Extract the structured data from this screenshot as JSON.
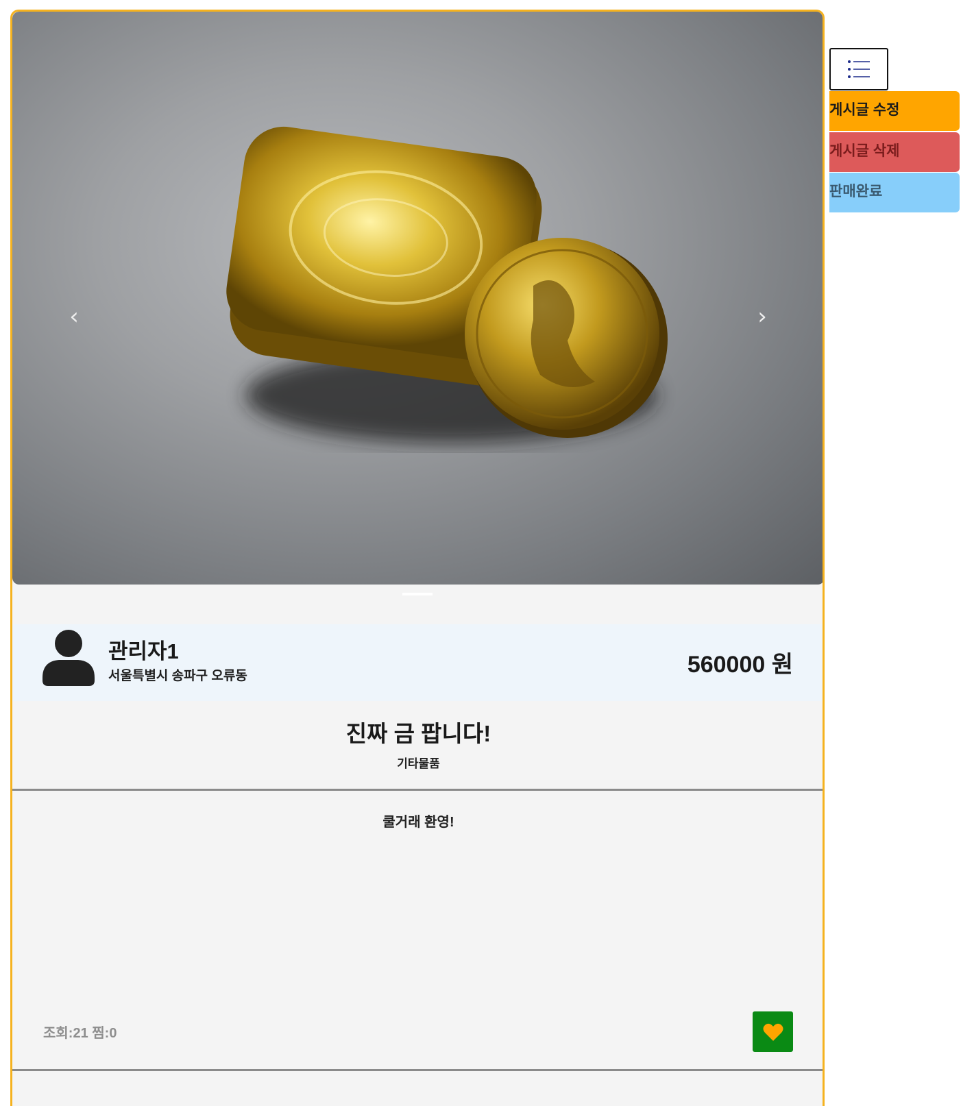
{
  "carousel": {
    "prev_glyph": "‹",
    "next_glyph": "›",
    "image_alt": "gold bar and coin"
  },
  "seller": {
    "name": "관리자1",
    "location": "서울특별시 송파구 오류동",
    "avatar_icon": "user-icon"
  },
  "price": "560000 원",
  "post": {
    "title": "진짜 금 팝니다!",
    "category": "기타물품",
    "body": "쿨거래 환영!",
    "stats": "조회:21 찜:0"
  },
  "like_button": {
    "icon": "heart-icon",
    "color": "#0a8a14",
    "icon_color": "#ffa500"
  },
  "side_menu": {
    "toggle_icon": "list-icon",
    "edit_label": "게시글 수정",
    "delete_label": "게시글 삭제",
    "sold_label": "판매완료"
  },
  "colors": {
    "border": "#f5b21f",
    "edit": "#ffa500",
    "delete": "#dd5a5a",
    "sold": "#87cefa"
  }
}
